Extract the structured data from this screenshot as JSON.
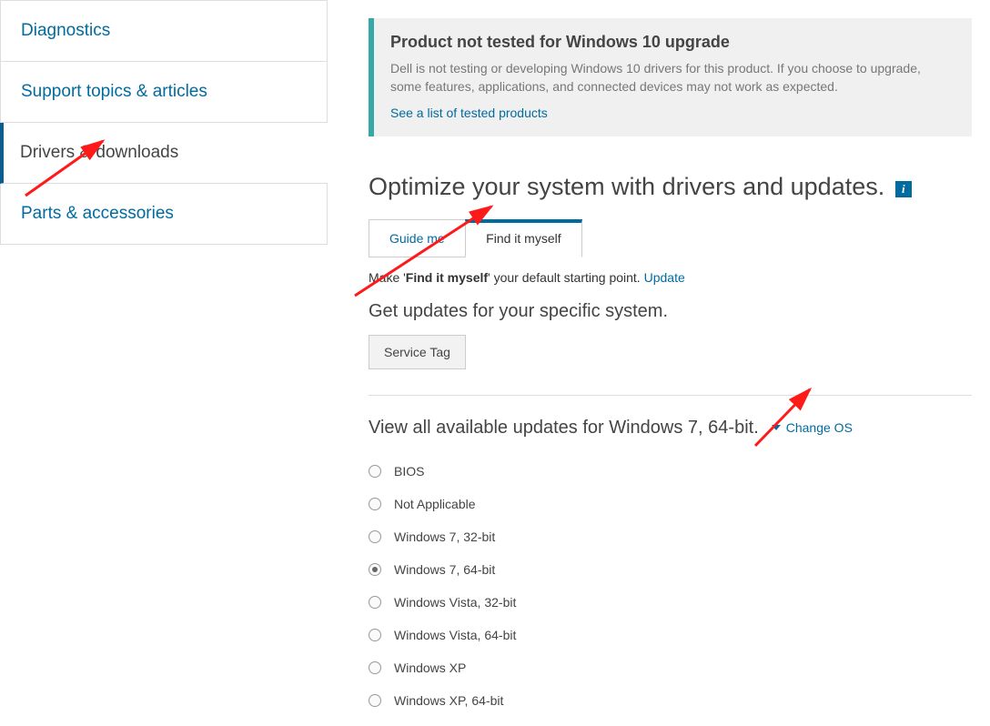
{
  "sidebar": {
    "items": [
      {
        "label": "Diagnostics",
        "active": false
      },
      {
        "label": "Support topics & articles",
        "active": false
      },
      {
        "label": "Drivers & downloads",
        "active": true
      },
      {
        "label": "Parts & accessories",
        "active": false
      }
    ]
  },
  "banner": {
    "title": "Product not tested for Windows 10 upgrade",
    "body": "Dell is not testing or developing Windows 10 drivers for this product. If you choose to upgrade, some features, applications, and connected devices may not work as expected.",
    "link": "See a list of tested products"
  },
  "heading": "Optimize your system with drivers and updates.",
  "tabs": [
    {
      "label": "Guide me",
      "active": false
    },
    {
      "label": "Find it myself",
      "active": true
    }
  ],
  "default_row": {
    "prefix": "Make '",
    "bold": "Find it myself",
    "suffix": "' your default starting point. ",
    "link": "Update"
  },
  "subheading": "Get updates for your specific system.",
  "service_tag_btn": "Service Tag",
  "view_text": "View all available updates for Windows 7, 64-bit.",
  "change_os": "Change OS",
  "os_options": [
    {
      "label": "BIOS",
      "selected": false
    },
    {
      "label": "Not Applicable",
      "selected": false
    },
    {
      "label": "Windows 7, 32-bit",
      "selected": false
    },
    {
      "label": "Windows 7, 64-bit",
      "selected": true
    },
    {
      "label": "Windows Vista, 32-bit",
      "selected": false
    },
    {
      "label": "Windows Vista, 64-bit",
      "selected": false
    },
    {
      "label": "Windows XP",
      "selected": false
    },
    {
      "label": "Windows XP, 64-bit",
      "selected": false
    }
  ]
}
